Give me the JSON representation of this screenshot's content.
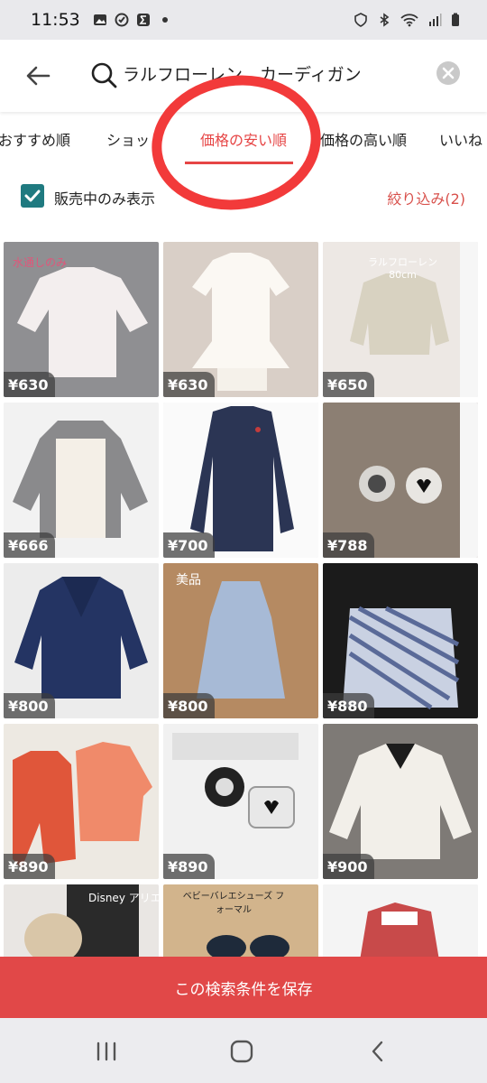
{
  "status_bar": {
    "time": "11:53",
    "left_icons": [
      "image-icon",
      "check-circle-icon",
      "sigma-icon",
      "dot-icon"
    ],
    "right_icons": [
      "shield-icon",
      "bluetooth-icon",
      "wifi-icon",
      "signal-icon",
      "battery-icon"
    ]
  },
  "search": {
    "query": "ラルフローレン　カーディガン"
  },
  "sort_tabs": [
    {
      "label": "おすすめ順",
      "active": false
    },
    {
      "label": "ショップ",
      "active": false
    },
    {
      "label": "価格の安い順",
      "active": true
    },
    {
      "label": "価格の高い順",
      "active": false
    },
    {
      "label": "いいね",
      "active": false
    }
  ],
  "filter": {
    "checkbox_label": "販売中のみ表示",
    "checked": true,
    "refine_label": "絞り込み(2)"
  },
  "items": [
    {
      "price": "¥630",
      "overlay": "水通しのみ"
    },
    {
      "price": "¥630",
      "overlay": ""
    },
    {
      "price": "¥650",
      "overlay": "ラルフローレン\n80cm"
    },
    {
      "price": "¥666",
      "overlay": ""
    },
    {
      "price": "¥700",
      "overlay": ""
    },
    {
      "price": "¥788",
      "overlay": ""
    },
    {
      "price": "¥800",
      "overlay": ""
    },
    {
      "price": "¥800",
      "overlay": "美品"
    },
    {
      "price": "¥880",
      "overlay": ""
    },
    {
      "price": "¥890",
      "overlay": ""
    },
    {
      "price": "¥890",
      "overlay": ""
    },
    {
      "price": "¥900",
      "overlay": ""
    },
    {
      "price": "",
      "overlay": "Disney アリエル"
    },
    {
      "price": "",
      "overlay": "ベビーバレエシューズ フォーマル"
    },
    {
      "price": "",
      "overlay": ""
    }
  ],
  "save_button": {
    "label": "この検索条件を保存"
  },
  "colors": {
    "accent": "#e64545",
    "save_bar": "#e14848",
    "checkbox": "#1f7a80"
  }
}
